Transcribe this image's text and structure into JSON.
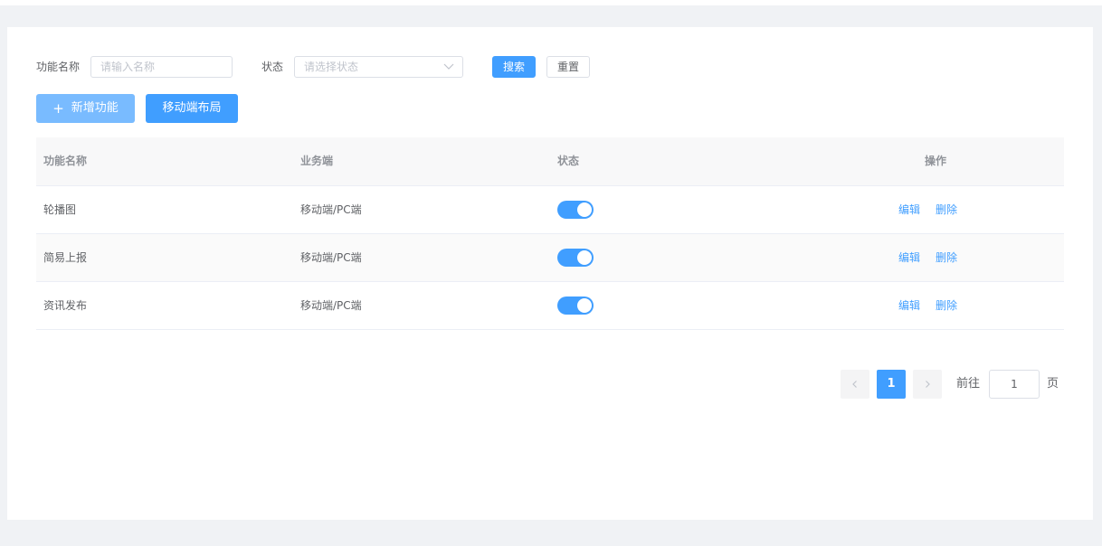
{
  "search": {
    "name_label": "功能名称",
    "name_placeholder": "请输入名称",
    "name_value": "",
    "status_label": "状态",
    "status_placeholder": "请选择状态",
    "search_button": "搜索",
    "reset_button": "重置"
  },
  "toolbar": {
    "add_button": "新增功能",
    "layout_button": "移动端布局"
  },
  "table": {
    "columns": {
      "name": "功能名称",
      "platform": "业务端",
      "status": "状态",
      "actions": "操作"
    },
    "rows": [
      {
        "name": "轮播图",
        "platform": "移动端/PC端",
        "enabled": true,
        "edit": "编辑",
        "delete": "删除"
      },
      {
        "name": "简易上报",
        "platform": "移动端/PC端",
        "enabled": true,
        "edit": "编辑",
        "delete": "删除"
      },
      {
        "name": "资讯发布",
        "platform": "移动端/PC端",
        "enabled": true,
        "edit": "编辑",
        "delete": "删除"
      }
    ]
  },
  "pagination": {
    "current_page": "1",
    "goto_label": "前往",
    "goto_value": "1",
    "page_suffix": "页"
  },
  "colors": {
    "primary": "#409eff",
    "primary_light": "#79bbff",
    "page_bg": "#f0f2f5"
  }
}
